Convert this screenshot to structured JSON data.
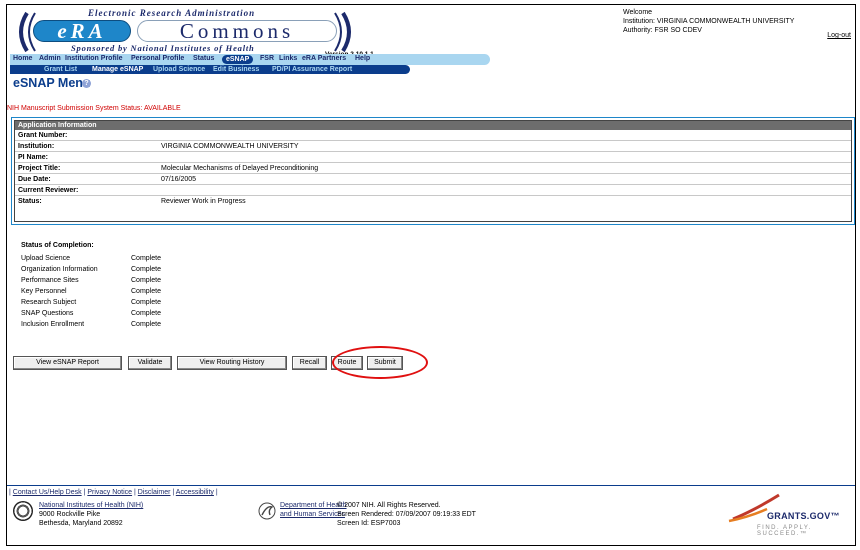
{
  "header": {
    "tagline_top": "Electronic Research Administration",
    "logo_era": "eRA",
    "logo_commons": "Commons",
    "tagline_bottom": "Sponsored by National Institutes of Health",
    "version": "Version 2.10.1.1",
    "welcome": "Welcome",
    "institution": "Institution: VIRGINIA COMMONWEALTH UNIVERSITY",
    "authority": "Authority:  FSR  SO  CDEV",
    "logout": "Log-out"
  },
  "nav_primary": {
    "home": "Home",
    "admin": "Admin",
    "institution_profile": "Institution Profile",
    "personal_profile": "Personal Profile",
    "status": "Status",
    "esnap": "eSNAP",
    "fsr": "FSR",
    "links": "Links",
    "era_partners": "eRA Partners",
    "help": "Help"
  },
  "nav_secondary": {
    "grant_list": "Grant List",
    "manage_esnap": "Manage eSNAP",
    "upload_science": "Upload Science",
    "edit_business": "Edit Business",
    "pdpi_assurance": "PD/PI Assurance Report"
  },
  "page": {
    "title": "eSNAP Menu",
    "system_status": "NIH Manuscript Submission System Status: AVAILABLE"
  },
  "application_info": {
    "header": "Application Information",
    "rows": [
      {
        "label": "Grant Number:",
        "value": ""
      },
      {
        "label": "Institution:",
        "value": "VIRGINIA COMMONWEALTH UNIVERSITY"
      },
      {
        "label": "PI Name:",
        "value": ""
      },
      {
        "label": "Project Title:",
        "value": "Molecular Mechanisms of Delayed Preconditioning"
      },
      {
        "label": "Due Date:",
        "value": "07/16/2005"
      },
      {
        "label": "Current Reviewer:",
        "value": ""
      },
      {
        "label": "Status:",
        "value": "Reviewer Work in Progress"
      }
    ]
  },
  "completion": {
    "title": "Status of Completion:",
    "items": [
      {
        "label": "Upload Science",
        "status": "Complete"
      },
      {
        "label": "Organization Information",
        "status": "Complete"
      },
      {
        "label": "Performance Sites",
        "status": "Complete"
      },
      {
        "label": "Key Personnel",
        "status": "Complete"
      },
      {
        "label": "Research Subject",
        "status": "Complete"
      },
      {
        "label": "SNAP Questions",
        "status": "Complete"
      },
      {
        "label": "Inclusion Enrollment",
        "status": "Complete"
      }
    ]
  },
  "actions": {
    "view_report": "View eSNAP Report",
    "validate": "Validate",
    "view_routing": "View Routing History",
    "recall": "Recall",
    "route": "Route",
    "submit": "Submit"
  },
  "footer": {
    "contact": "Contact Us/Help Desk",
    "privacy": "Privacy Notice",
    "disclaimer": "Disclaimer",
    "accessibility": "Accessibility",
    "nih_name": "National Institutes of Health (NIH)",
    "nih_addr1": "9000 Rockville Pike",
    "nih_addr2": "Bethesda, Maryland 20892",
    "hhs_line1": "Department of Health",
    "hhs_line2": "and Human Services",
    "copyright": "© 2007 NIH. All Rights Reserved.",
    "rendered": "Screen Rendered: 07/09/2007 09:19:33 EDT",
    "screen_id": "Screen Id: ESP7003",
    "grants_gov": "GRANTS.GOV™",
    "grants_gov_tag": "FIND. APPLY. SUCCEED.™"
  },
  "colors": {
    "brand_dark": "#0b3d8c",
    "brand_light": "#a9d6f0",
    "status_red": "#d00000",
    "highlight_circle": "#e01010"
  }
}
